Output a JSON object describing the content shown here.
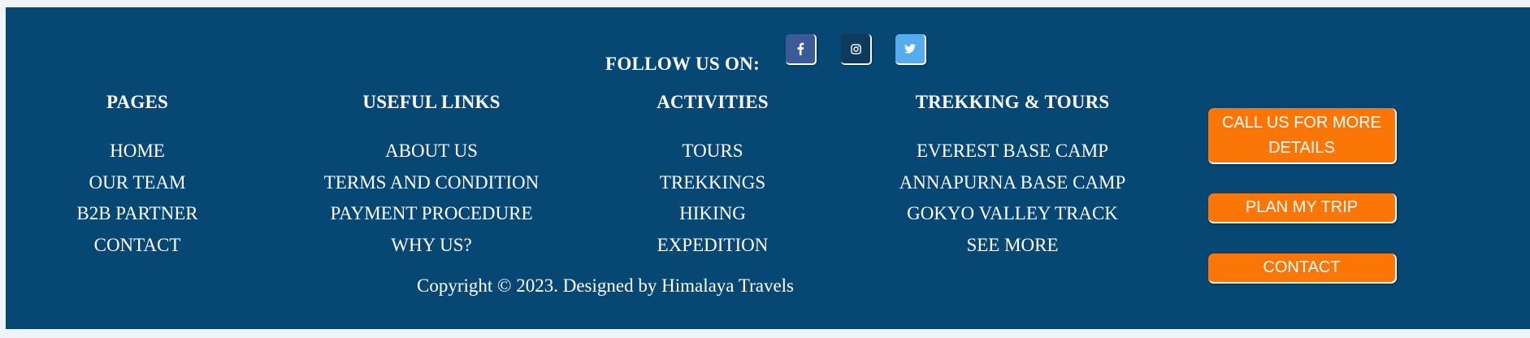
{
  "follow": {
    "label": "FOLLOW US ON:",
    "social": [
      {
        "name": "facebook",
        "icon": "facebook-icon",
        "color": "#3b5b98"
      },
      {
        "name": "instagram",
        "icon": "instagram-icon",
        "color": "#0e3a5e"
      },
      {
        "name": "twitter",
        "icon": "twitter-icon",
        "color": "#55acee"
      }
    ]
  },
  "columns": {
    "pages": {
      "heading": "PAGES",
      "links": [
        "HOME",
        "OUR TEAM",
        "B2B PARTNER",
        "CONTACT"
      ]
    },
    "useful_links": {
      "heading": "USEFUL LINKS",
      "links": [
        "ABOUT US",
        "TERMS AND CONDITION",
        "PAYMENT PROCEDURE",
        "WHY US?"
      ]
    },
    "activities": {
      "heading": "ACTIVITIES",
      "links": [
        "TOURS",
        "TREKKINGS",
        "HIKING",
        "EXPEDITION"
      ]
    },
    "trekking": {
      "heading": "TREKKING & TOURS",
      "links": [
        "EVEREST BASE CAMP",
        "ANNAPURNA BASE CAMP",
        "GOKYO VALLEY TRACK",
        "SEE MORE"
      ]
    }
  },
  "copyright": "Copyright © 2023. Designed by Himalaya Travels",
  "cta": {
    "call": "CALL US FOR MORE DETAILS",
    "plan": "PLAN MY TRIP",
    "contact": "CONTACT"
  },
  "colors": {
    "footer_bg": "#074774",
    "cta_bg": "#fb7507",
    "page_bg": "#eef4fa"
  }
}
